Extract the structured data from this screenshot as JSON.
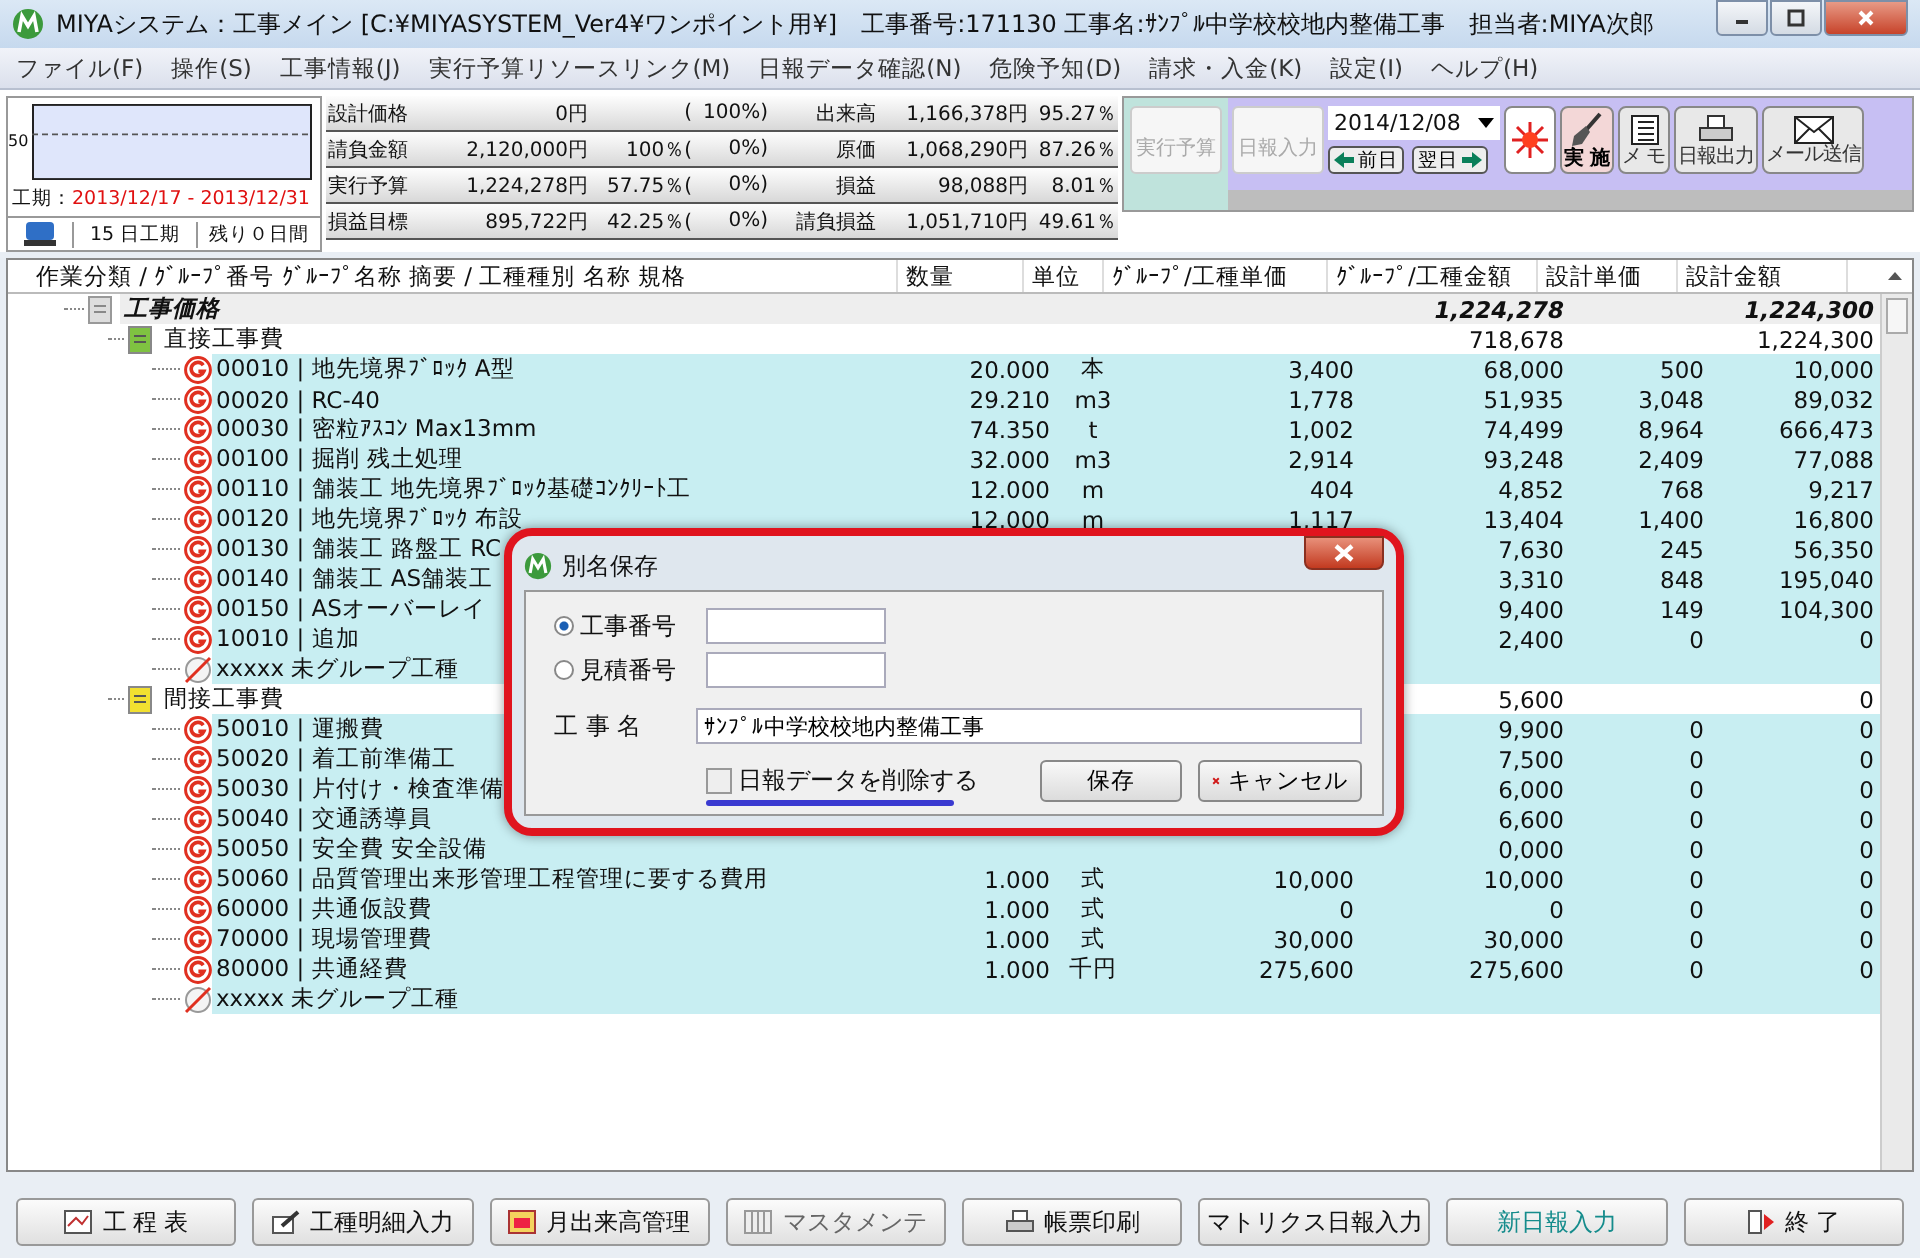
{
  "window": {
    "title": "MIYAシステム：工事メイン [C:¥MIYASYSTEM_Ver4¥ワンポイント用¥]　工事番号:171130 工事名:ｻﾝﾌﾟﾙ中学校校地内整備工事　担当者:MIYA次郎"
  },
  "menu": [
    "ファイル(F)",
    "操作(S)",
    "工事情報(J)",
    "実行予算リソースリンク(M)",
    "日報データ確認(N)",
    "危険予知(D)",
    "請求・入金(K)",
    "設定(I)",
    "ヘルプ(H)"
  ],
  "schedule": {
    "axis_label": "50",
    "period_label": "工期：",
    "period": "2013/12/17 - 2013/12/31",
    "duration": "15 日工期",
    "remaining": "残り０日間"
  },
  "summary_left": [
    {
      "label": "設計価格",
      "amount": "0円",
      "ratio": "(",
      "ratio2": "100%)"
    },
    {
      "label": "請負金額",
      "amount": "2,120,000円",
      "ratio": "100％(",
      "ratio2": "0%)"
    },
    {
      "label": "実行予算",
      "amount": "1,224,278円",
      "ratio": "57.75％(",
      "ratio2": "0%)"
    },
    {
      "label": "損益目標",
      "amount": "895,722円",
      "ratio": "42.25％(",
      "ratio2": "0%)"
    }
  ],
  "summary_right": [
    {
      "label": "出来高",
      "amount": "1,166,378円",
      "ratio": "95.27％"
    },
    {
      "label": "原価",
      "amount": "1,068,290円",
      "ratio": "87.26％"
    },
    {
      "label": "損益",
      "amount": "98,088円",
      "ratio": "8.01％"
    },
    {
      "label": "請負損益",
      "amount": "1,051,710円",
      "ratio": "49.61％"
    }
  ],
  "toolbar": {
    "budget_button": {
      "label": "実行予算",
      "disabled": true
    },
    "report_button": {
      "label": "日報入力",
      "disabled": true
    },
    "date": "2014/12/08",
    "prev_button": "前日",
    "next_button": "翌日",
    "action_buttons": [
      {
        "kind": "sun"
      },
      {
        "kind": "shovel",
        "label": "実 施"
      },
      {
        "kind": "memo",
        "label": "メ モ"
      },
      {
        "kind": "print",
        "label": "日報出力"
      },
      {
        "kind": "mail",
        "label": "メール送信"
      }
    ]
  },
  "table": {
    "columns": [
      "作業分類 / ｸﾞﾙｰﾌﾟ番号 ｸﾞﾙｰﾌﾟ名称 摘要 / 工種種別 名称 規格",
      "数量",
      "単位",
      "ｸﾞﾙｰﾌﾟ/工種単価",
      "ｸﾞﾙｰﾌﾟ/工種金額",
      "設計単価",
      "設計金額"
    ],
    "root": {
      "name": "工事価格",
      "amount": "1,224,278",
      "design_amount": "1,224,300",
      "children": [
        {
          "name": "直接工事費",
          "amount": "718,678",
          "design_amount": "1,224,300",
          "color": "#7fc241",
          "children": [
            {
              "kind": "group",
              "name": "00010 | 地先境界ﾌﾞﾛｯｸ A型",
              "qty": "20.000",
              "unit": "本",
              "unit_price": "3,400",
              "amount": "68,000",
              "design_unit": "500",
              "design_amount": "10,000"
            },
            {
              "kind": "group",
              "name": "00020 | RC-40",
              "qty": "29.210",
              "unit": "m3",
              "unit_price": "1,778",
              "amount": "51,935",
              "design_unit": "3,048",
              "design_amount": "89,032"
            },
            {
              "kind": "group",
              "name": "00030 | 密粒ｱｽｺﾝ Max13mm",
              "qty": "74.350",
              "unit": "t",
              "unit_price": "1,002",
              "amount": "74,499",
              "design_unit": "8,964",
              "design_amount": "666,473"
            },
            {
              "kind": "group",
              "name": "00100 | 掘削 残土処理",
              "qty": "32.000",
              "unit": "m3",
              "unit_price": "2,914",
              "amount": "93,248",
              "design_unit": "2,409",
              "design_amount": "77,088"
            },
            {
              "kind": "group",
              "name": "00110 | 舗装工 地先境界ﾌﾞﾛｯｸ基礎ｺﾝｸﾘｰﾄ工",
              "qty": "12.000",
              "unit": "m",
              "unit_price": "404",
              "amount": "4,852",
              "design_unit": "768",
              "design_amount": "9,217"
            },
            {
              "kind": "group",
              "name": "00120 | 地先境界ﾌﾞﾛｯｸ 布設",
              "qty": "12.000",
              "unit": "m",
              "unit_price": "1,117",
              "amount": "13,404",
              "design_unit": "1,400",
              "design_amount": "16,800"
            },
            {
              "kind": "group",
              "name": "00130 | 舗装工 路盤工 RC",
              "amount": "7,630",
              "design_unit": "245",
              "design_amount": "56,350"
            },
            {
              "kind": "group",
              "name": "00140 | 舗装工 AS舗装工",
              "amount": "3,310",
              "design_unit": "848",
              "design_amount": "195,040"
            },
            {
              "kind": "group",
              "name": "00150 | ASオーバーレイ",
              "amount": "9,400",
              "design_unit": "149",
              "design_amount": "104,300"
            },
            {
              "kind": "group",
              "name": "10010 | 追加",
              "amount": "2,400",
              "design_unit": "0",
              "design_amount": "0"
            },
            {
              "kind": "ungrouped",
              "name": "xxxxx 未グループ工種"
            }
          ]
        },
        {
          "name": "間接工事費",
          "amount": "5,600",
          "design_amount": "0",
          "color": "#f2e030",
          "children": [
            {
              "kind": "group",
              "name": "50010 | 運搬費",
              "amount": "9,900",
              "design_unit": "0",
              "design_amount": "0"
            },
            {
              "kind": "group",
              "name": "50020 | 着工前準備工",
              "amount": "7,500",
              "design_unit": "0",
              "design_amount": "0"
            },
            {
              "kind": "group",
              "name": "50030 | 片付け・検査準備",
              "amount": "6,000",
              "design_unit": "0",
              "design_amount": "0"
            },
            {
              "kind": "group",
              "name": "50040 | 交通誘導員",
              "amount": "6,600",
              "design_unit": "0",
              "design_amount": "0"
            },
            {
              "kind": "group",
              "name": "50050 | 安全費 安全設備",
              "amount": "0,000",
              "design_unit": "0",
              "design_amount": "0"
            },
            {
              "kind": "group",
              "name": "50060 | 品質管理出来形管理工程管理に要する費用",
              "qty": "1.000",
              "unit": "式",
              "unit_price": "10,000",
              "amount": "10,000",
              "design_unit": "0",
              "design_amount": "0"
            },
            {
              "kind": "group",
              "name": "60000 | 共通仮設費",
              "qty": "1.000",
              "unit": "式",
              "unit_price": "0",
              "amount": "0",
              "design_unit": "0",
              "design_amount": "0"
            },
            {
              "kind": "group",
              "name": "70000 | 現場管理費",
              "qty": "1.000",
              "unit": "式",
              "unit_price": "30,000",
              "amount": "30,000",
              "design_unit": "0",
              "design_amount": "0"
            },
            {
              "kind": "group",
              "name": "80000 | 共通経費",
              "qty": "1.000",
              "unit": "千円",
              "unit_price": "275,600",
              "amount": "275,600",
              "design_unit": "0",
              "design_amount": "0"
            },
            {
              "kind": "ungrouped",
              "name": "xxxxx 未グループ工種"
            }
          ]
        }
      ]
    }
  },
  "dialog": {
    "title": "別名保存",
    "options": [
      {
        "label": "工事番号",
        "selected": true
      },
      {
        "label": "見積番号",
        "selected": false
      }
    ],
    "name_label": "工 事 名",
    "name_value": "ｻﾝﾌﾟﾙ中学校校地内整備工事",
    "delete_checkbox": {
      "label": "日報データを削除する",
      "checked": false
    },
    "save_button": "保存",
    "cancel_button": "キャンセル"
  },
  "bottom_buttons": [
    {
      "kind": "chart",
      "label": "工 程 表",
      "disabled": false,
      "highlighted": false
    },
    {
      "kind": "edit",
      "label": "工種明細入力",
      "disabled": false,
      "highlighted": false
    },
    {
      "kind": "calendar",
      "label": "月出来高管理",
      "disabled": false,
      "highlighted": false
    },
    {
      "kind": "columns",
      "label": "マスタメンテ",
      "disabled": true,
      "highlighted": false
    },
    {
      "kind": "print",
      "label": "帳票印刷",
      "disabled": false,
      "highlighted": false
    },
    {
      "kind": "none",
      "label": "マトリクス日報入力",
      "disabled": false,
      "highlighted": false
    },
    {
      "kind": "none",
      "label": "新日報入力",
      "disabled": false,
      "highlighted": true
    },
    {
      "kind": "exit",
      "label": "終 了",
      "disabled": false,
      "highlighted": false
    }
  ]
}
